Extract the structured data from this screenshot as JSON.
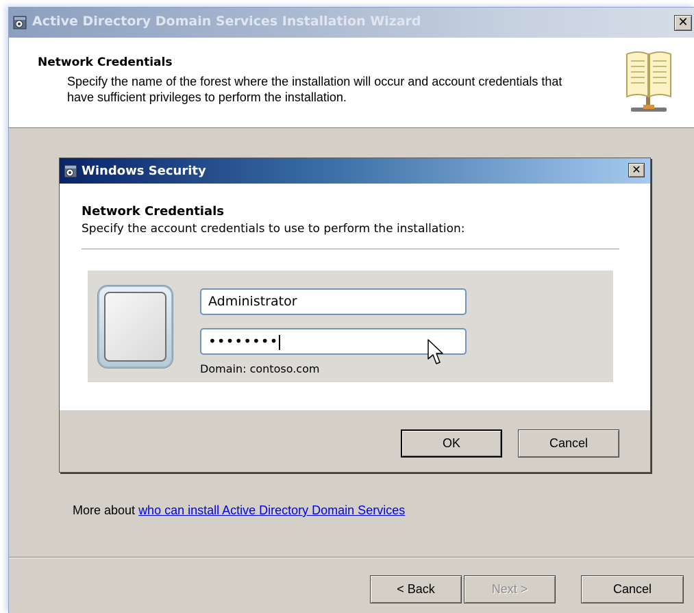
{
  "wizard": {
    "title": "Active Directory Domain Services Installation Wizard",
    "close_glyph": "✕",
    "header": {
      "title": "Network Credentials",
      "description": "Specify the name of the forest where the installation will occur and account credentials that have sufficient privileges to perform the installation.",
      "icon": "book-icon"
    },
    "more_about_prefix": "More about ",
    "more_about_link": "who can install Active Directory Domain Services",
    "buttons": {
      "back": "< Back",
      "next": "Next >",
      "cancel": "Cancel"
    }
  },
  "security_dialog": {
    "title": "Windows Security",
    "close_glyph": "✕",
    "heading": "Network Credentials",
    "description": "Specify the account credentials to use to perform the installation:",
    "username_value": "Administrator",
    "password_mask": "••••••••",
    "domain_label": "Domain: contoso.com",
    "buttons": {
      "ok": "OK",
      "cancel": "Cancel"
    }
  },
  "colors": {
    "dialog_titlebar": "#0a246a",
    "input_border": "#6f94be",
    "link": "#0000ee",
    "face": "#d4d0c8"
  }
}
